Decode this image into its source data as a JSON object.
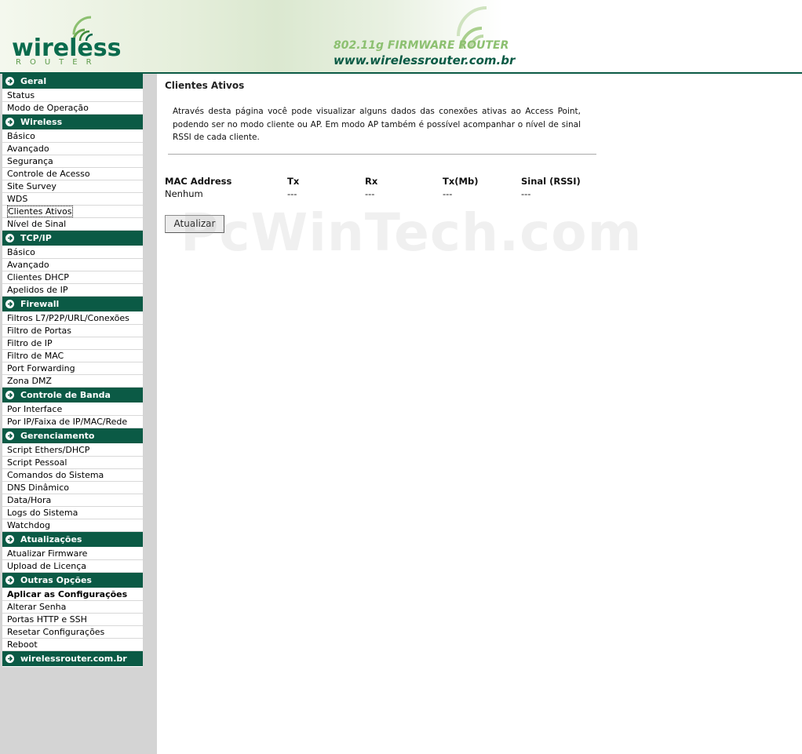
{
  "header": {
    "logo_word": "wireless",
    "logo_sub": "ROUTER",
    "tagline": "802.11g FIRMWARE ROUTER",
    "url": "www.wirelessrouter.com.br"
  },
  "sidebar": {
    "sections": [
      {
        "title": "Geral",
        "items": [
          "Status",
          "Modo de Operação"
        ]
      },
      {
        "title": "Wireless",
        "items": [
          "Básico",
          "Avançado",
          "Segurança",
          "Controle de Acesso",
          "Site Survey",
          "WDS",
          "Clientes Ativos",
          "Nível de Sinal"
        ]
      },
      {
        "title": "TCP/IP",
        "items": [
          "Básico",
          "Avançado",
          "Clientes DHCP",
          "Apelidos de IP"
        ]
      },
      {
        "title": "Firewall",
        "items": [
          "Filtros L7/P2P/URL/Conexões",
          "Filtro de Portas",
          "Filtro de IP",
          "Filtro de MAC",
          "Port Forwarding",
          "Zona DMZ"
        ]
      },
      {
        "title": "Controle de Banda",
        "items": [
          "Por Interface",
          "Por IP/Faixa de IP/MAC/Rede"
        ]
      },
      {
        "title": "Gerenciamento",
        "items": [
          "Script Ethers/DHCP",
          "Script Pessoal",
          "Comandos do Sistema",
          "DNS Dinâmico",
          "Data/Hora",
          "Logs do Sistema",
          "Watchdog"
        ]
      },
      {
        "title": "Atualizações",
        "items": [
          "Atualizar Firmware",
          "Upload de Licença"
        ]
      },
      {
        "title": "Outras Opções",
        "items": [
          "Aplicar as Configurações",
          "Alterar Senha",
          "Portas HTTP e SSH",
          "Resetar Configurações",
          "Reboot"
        ]
      },
      {
        "title": "wirelessrouter.com.br",
        "items": []
      }
    ],
    "selected": "Clientes Ativos",
    "bold_item": "Aplicar as Configurações"
  },
  "main": {
    "title": "Clientes Ativos",
    "description": "Através desta página você pode visualizar alguns dados das conexões ativas ao Access Point, podendo ser no modo cliente ou AP. Em modo AP também é possível acompanhar o nível de sinal RSSI de cada cliente.",
    "table": {
      "headers": [
        "MAC Address",
        "Tx",
        "Rx",
        "Tx(Mb)",
        "Sinal (RSSI)"
      ],
      "row": [
        "Nenhum",
        "---",
        "---",
        "---",
        "---"
      ]
    },
    "refresh_button": "Atualizar"
  },
  "watermark": "PcWinTech.com",
  "colors": {
    "brand_green": "#0b5a45",
    "sidebar_bg": "#d4d4d4",
    "accent_light_green": "#8cc070"
  }
}
